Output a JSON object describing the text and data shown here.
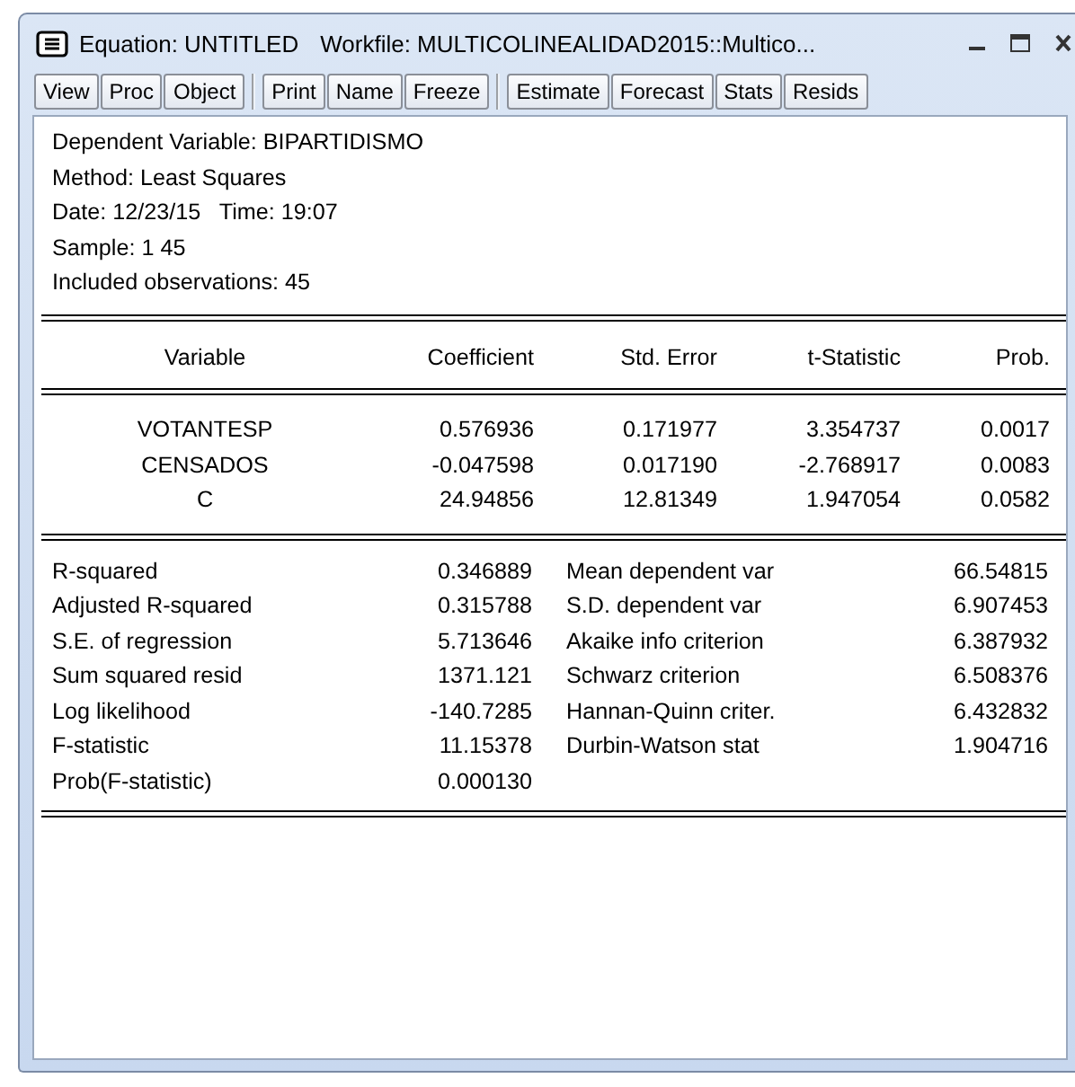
{
  "window": {
    "title": "Equation: UNTITLED",
    "workfile": "Workfile: MULTICOLINEALIDAD2015::Multico..."
  },
  "toolbar": [
    [
      "View",
      "Proc",
      "Object"
    ],
    [
      "Print",
      "Name",
      "Freeze"
    ],
    [
      "Estimate",
      "Forecast",
      "Stats",
      "Resids"
    ]
  ],
  "header_lines": [
    "Dependent Variable: BIPARTIDISMO",
    "Method: Least Squares",
    "Date: 12/23/15   Time: 19:07",
    "Sample: 1 45",
    "Included observations: 45"
  ],
  "coefficients": {
    "columns": [
      "Variable",
      "Coefficient",
      "Std. Error",
      "t-Statistic",
      "Prob."
    ],
    "rows": [
      [
        "VOTANTESP",
        "0.576936",
        "0.171977",
        "3.354737",
        "0.0017"
      ],
      [
        "CENSADOS",
        "-0.047598",
        "0.017190",
        "-2.768917",
        "0.0083"
      ],
      [
        "C",
        "24.94856",
        "12.81349",
        "1.947054",
        "0.0582"
      ]
    ]
  },
  "statistics": [
    [
      "R-squared",
      "0.346889",
      "Mean dependent var",
      "66.54815"
    ],
    [
      "Adjusted R-squared",
      "0.315788",
      "S.D. dependent var",
      "6.907453"
    ],
    [
      "S.E. of regression",
      "5.713646",
      "Akaike info criterion",
      "6.387932"
    ],
    [
      "Sum squared resid",
      "1371.121",
      "Schwarz criterion",
      "6.508376"
    ],
    [
      "Log likelihood",
      "-140.7285",
      "Hannan-Quinn criter.",
      "6.432832"
    ],
    [
      "F-statistic",
      "11.15378",
      "Durbin-Watson stat",
      "1.904716"
    ],
    [
      "Prob(F-statistic)",
      "0.000130"
    ]
  ]
}
